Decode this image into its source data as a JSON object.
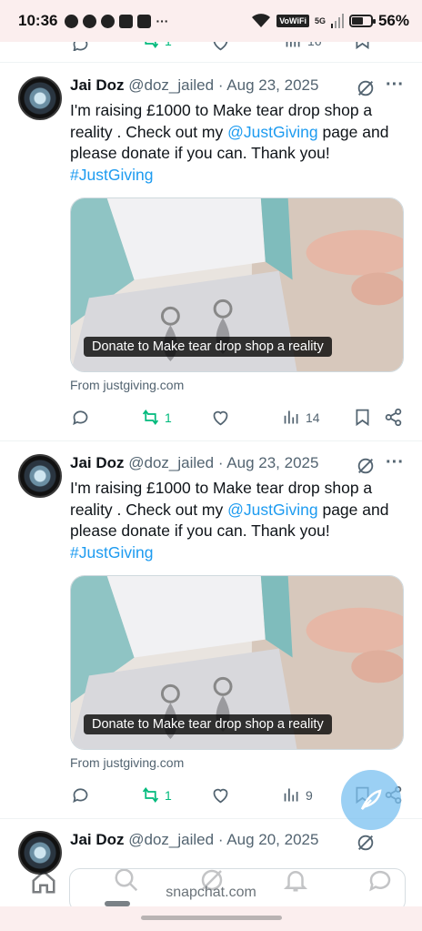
{
  "status_bar": {
    "time": "10:36",
    "more_indicator": "···",
    "volte": "VoWiFi",
    "network": "5G",
    "battery_percent": "56%",
    "battery_level": 0.56
  },
  "partial_top_actions": {
    "retweets": "1",
    "views": "16"
  },
  "tweets": [
    {
      "author_name": "Jai Doz",
      "author_handle": "@doz_jailed",
      "separator": "·",
      "date": "Aug 23, 2025",
      "text_before_mention": "I'm raising £1000 to Make tear drop shop a reality . Check out my ",
      "mention": "@JustGiving",
      "text_after_mention": " page and please donate if you can. Thank you!",
      "hashtag": "#JustGiving",
      "card_caption": "Donate to Make tear drop shop a reality",
      "card_source": "From justgiving.com",
      "retweets": "1",
      "views": "14"
    },
    {
      "author_name": "Jai Doz",
      "author_handle": "@doz_jailed",
      "separator": "·",
      "date": "Aug 23, 2025",
      "text_before_mention": "I'm raising £1000 to Make tear drop shop a reality . Check out my ",
      "mention": "@JustGiving",
      "text_after_mention": " page and please donate if you can. Thank you!",
      "hashtag": "#JustGiving",
      "card_caption": "Donate to Make tear drop shop a reality",
      "card_source": "From justgiving.com",
      "retweets": "1",
      "views": "9"
    },
    {
      "author_name": "Jai Doz",
      "author_handle": "@doz_jailed",
      "separator": "·",
      "date": "Aug 20, 2025"
    }
  ],
  "bottom_bar": {
    "snapchat_label": "snapchat.com"
  },
  "colors": {
    "accent": "#1d9bf0",
    "retweet_green": "#00ba7c",
    "muted": "#536471",
    "status_bg": "#fbeeee"
  }
}
